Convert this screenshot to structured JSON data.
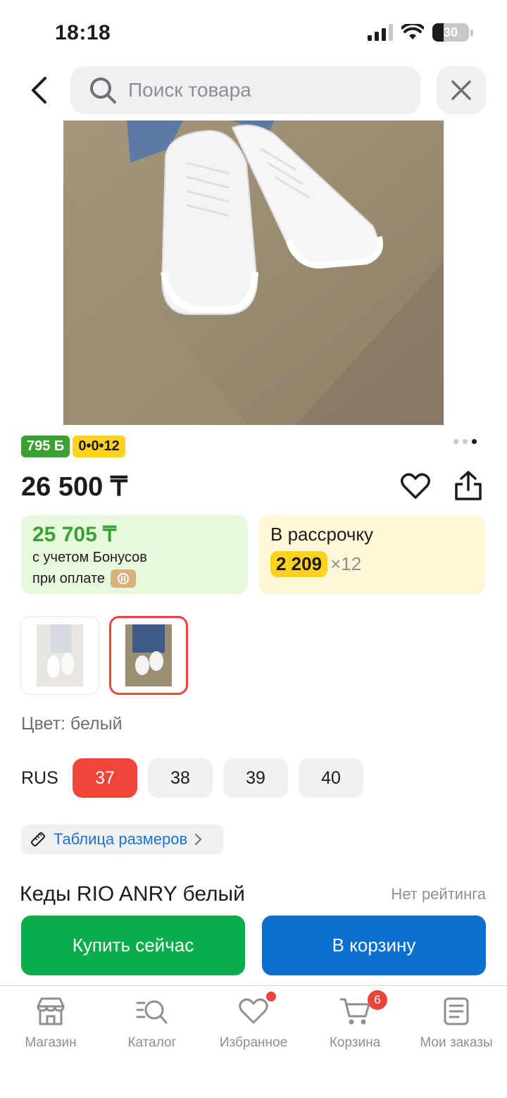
{
  "status_bar": {
    "time": "18:18",
    "battery": "30"
  },
  "header": {
    "search_placeholder": "Поиск товара"
  },
  "badges": {
    "bonus": "795 Б",
    "installment": "0•0•12"
  },
  "gallery": {
    "image_count": 3,
    "active_index": 2
  },
  "price": {
    "current": "26 500 ₸"
  },
  "bonus_card": {
    "price": "25 705 ₸",
    "line1": "с учетом Бонусов",
    "line2": "при оплате"
  },
  "installment_card": {
    "title": "В рассрочку",
    "amount": "2 209",
    "multiplier": "×12"
  },
  "color": {
    "label": "Цвет: белый"
  },
  "sizes": {
    "system": "RUS",
    "options": [
      "37",
      "38",
      "39",
      "40"
    ],
    "selected": "37"
  },
  "size_table": {
    "label": "Таблица размеров"
  },
  "product": {
    "title": "Кеды RIO ANRY белый",
    "rating": "Нет рейтинга"
  },
  "actions": {
    "buy_now": "Купить сейчас",
    "add_to_cart": "В корзину"
  },
  "bottom_nav": {
    "items": [
      {
        "label": "Магазин",
        "icon": "store-icon"
      },
      {
        "label": "Каталог",
        "icon": "catalog-search-icon"
      },
      {
        "label": "Избранное",
        "icon": "heart-icon"
      },
      {
        "label": "Корзина",
        "icon": "cart-icon",
        "badge": "6"
      },
      {
        "label": "Мои заказы",
        "icon": "orders-icon"
      }
    ]
  },
  "colors": {
    "green": "#0aac4c",
    "blue": "#0a6fcf",
    "red": "#f0453a",
    "yellow": "#ffd21f",
    "link": "#1a74d2"
  }
}
